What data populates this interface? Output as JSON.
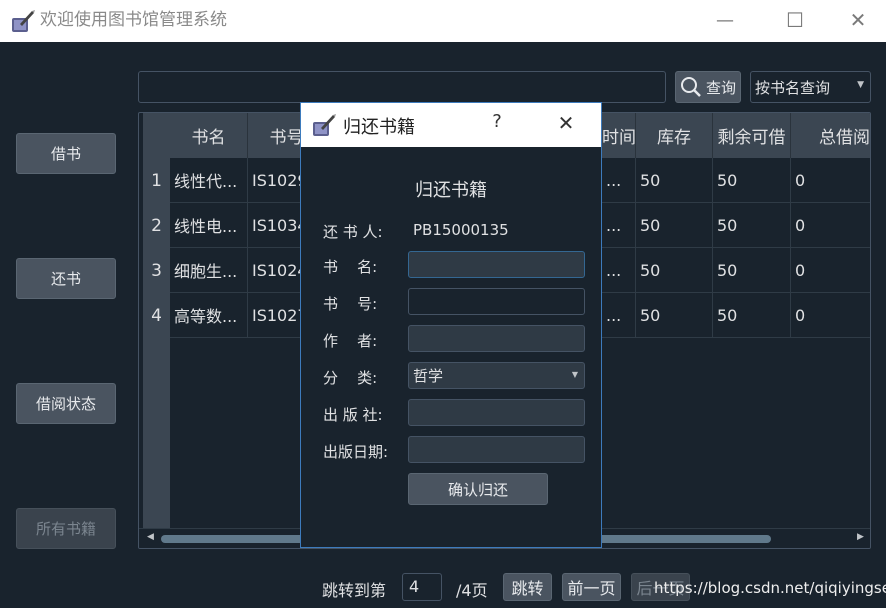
{
  "window": {
    "title": "欢迎使用图书馆管理系统",
    "minimize_glyph": "—",
    "maximize_glyph": "☐",
    "close_glyph": "✕"
  },
  "search": {
    "value": "",
    "button_label": "查询",
    "mode_selected": "按书名查询"
  },
  "sidebar": {
    "borrow_label": "借书",
    "return_label": "还书",
    "status_label": "借阅状态",
    "all_books_label": "所有书籍"
  },
  "table": {
    "columns": [
      "书名",
      "书号",
      "时间",
      "库存",
      "剩余可借",
      "总借阅"
    ],
    "rows": [
      {
        "num": "1",
        "title": "线性代...",
        "isbn": "IS1029",
        "time": "...",
        "stock": "50",
        "available": "50",
        "total": "0"
      },
      {
        "num": "2",
        "title": "线性电...",
        "isbn": "IS1034",
        "time": "...",
        "stock": "50",
        "available": "50",
        "total": "0"
      },
      {
        "num": "3",
        "title": "细胞生...",
        "isbn": "IS1024",
        "time": "...",
        "stock": "50",
        "available": "50",
        "total": "0"
      },
      {
        "num": "4",
        "title": "高等数...",
        "isbn": "IS1027",
        "time": "...",
        "stock": "50",
        "available": "50",
        "total": "0"
      }
    ]
  },
  "pager": {
    "jump_label": "跳转到第",
    "page_value": "4",
    "total_label": "/4页",
    "jump_button": "跳转",
    "prev_button": "前一页",
    "next_button": "后一页"
  },
  "watermark": "https://blog.csdn.net/qiqiyingse",
  "dialog": {
    "title": "归还书籍",
    "help_glyph": "?",
    "close_glyph": "✕",
    "heading": "归还书籍",
    "returner_label": "还 书 人:",
    "returner_value": "PB15000135",
    "name_label": "书    名:",
    "number_label": "书    号:",
    "author_label": "作    者:",
    "category_label": "分    类:",
    "category_value": "哲学",
    "publisher_label": "出 版 社:",
    "date_label": "出版日期:",
    "confirm_label": "确认归还",
    "name_value": "",
    "number_value": "",
    "author_value": "",
    "publisher_value": "",
    "date_value": ""
  }
}
